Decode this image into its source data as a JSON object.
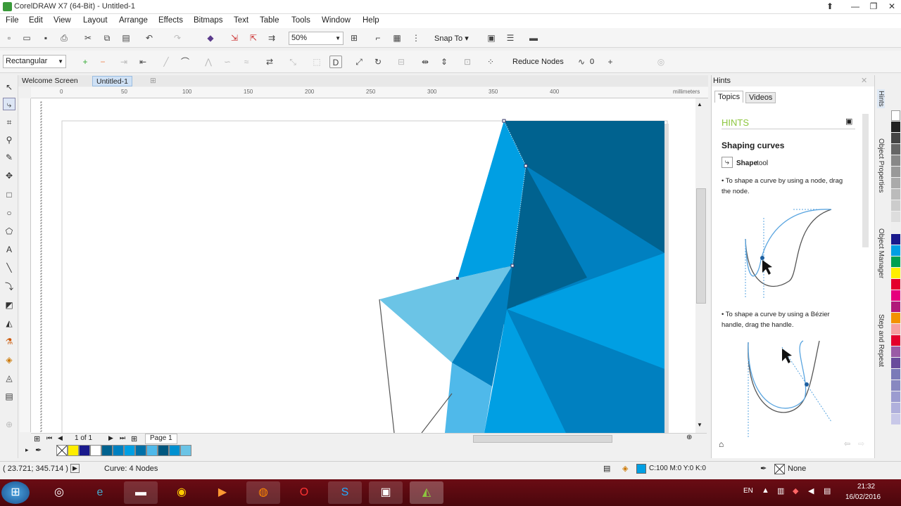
{
  "window": {
    "title": "CorelDRAW X7 (64-Bit) - Untitled-1"
  },
  "menu": [
    "File",
    "Edit",
    "View",
    "Layout",
    "Arrange",
    "Effects",
    "Bitmaps",
    "Text",
    "Table",
    "Tools",
    "Window",
    "Help"
  ],
  "standard_toolbar": {
    "zoom_level": "50%",
    "snap_to": "Snap To"
  },
  "property_bar": {
    "curve_style": "Rectangular",
    "reduce_nodes": "Reduce Nodes",
    "smoothness_value": "0"
  },
  "doc_tabs": [
    "Welcome Screen",
    "Untitled-1"
  ],
  "ruler": {
    "h_labels": [
      "0",
      "50",
      "100",
      "150",
      "200",
      "250",
      "300",
      "350",
      "400"
    ],
    "units": "millimeters"
  },
  "page_nav": {
    "counter": "1 of 1",
    "page_tab": "Page 1"
  },
  "status": {
    "coordinates": "( 23.721; 345.714 )",
    "selection_info": "Curve: 4 Nodes",
    "fill_info": "C:100 M:0 Y:0 K:0",
    "outline_info": "None"
  },
  "hints": {
    "panel_title": "Hints",
    "tabs": [
      "Topics",
      "Videos"
    ],
    "heading": "HINTS",
    "subheading": "Shaping curves",
    "tool_name": "Shape",
    "tool_suffix": "tool",
    "tip1": "• To shape a curve by using a node, drag the node.",
    "tip2": "• To shape a curve by using a Bézier handle, drag the handle."
  },
  "docker_tabs": [
    "Hints",
    "Object Properties",
    "Object Manager",
    "Step and Repeat"
  ],
  "taskbar": {
    "language": "EN",
    "time": "21:32",
    "date": "16/02/2016"
  },
  "colors": {
    "dark_blue": "#00628F",
    "mid_blue": "#0080C0",
    "bright_blue": "#009FE3",
    "light_blue": "#6BC4E6",
    "accent_green": "#8DC63F"
  }
}
